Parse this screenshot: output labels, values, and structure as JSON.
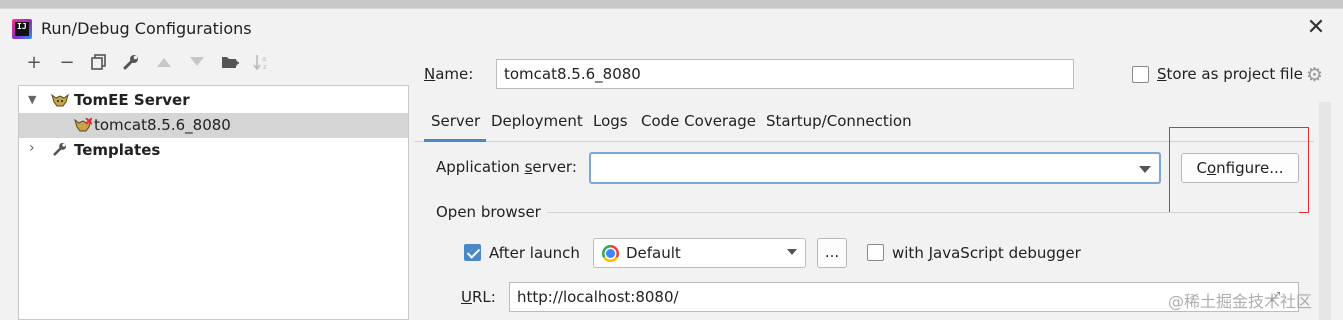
{
  "window": {
    "title": "Run/Debug Configurations"
  },
  "toolbar": {
    "items": [
      "add-icon",
      "remove-icon",
      "copy-icon",
      "wrench-icon",
      "move-up-icon",
      "move-down-icon",
      "new-folder-icon",
      "sort-icon"
    ]
  },
  "tree": {
    "group": "TomEE Server",
    "child": "tomcat8.5.6_8080",
    "templates": "Templates"
  },
  "form": {
    "name_label_prefix": "N",
    "name_label_rest": "ame:",
    "name_value": "tomcat8.5.6_8080",
    "store_prefix": "S",
    "store_rest": "tore as project file",
    "store_checked": false
  },
  "tabs": [
    "Server",
    "Deployment",
    "Logs",
    "Code Coverage",
    "Startup/Connection"
  ],
  "active_tab": "Server",
  "server": {
    "app_server_label_a": "Application ",
    "app_server_label_u": "s",
    "app_server_label_b": "erver:",
    "app_server_value": "",
    "configure_label_a": "C",
    "configure_label_u": "o",
    "configure_label_b": "nfigure..."
  },
  "open_browser": {
    "section_label": "Open browser",
    "after_launch_label": "After launch",
    "after_launch_checked": true,
    "browser_value": "Default",
    "dots_label": "...",
    "js_debugger_a": "with ",
    "js_debugger_u": "J",
    "js_debugger_b": "avaScript debugger",
    "js_debugger_checked": false,
    "url_label_u": "U",
    "url_label_b": "RL:",
    "url_value": "http://localhost:8080/"
  },
  "watermark": "@稀土掘金技术社区",
  "colors": {
    "accent": "#4a88c7",
    "highlight_box": "#e03030",
    "selection": "#d5d5d5"
  }
}
